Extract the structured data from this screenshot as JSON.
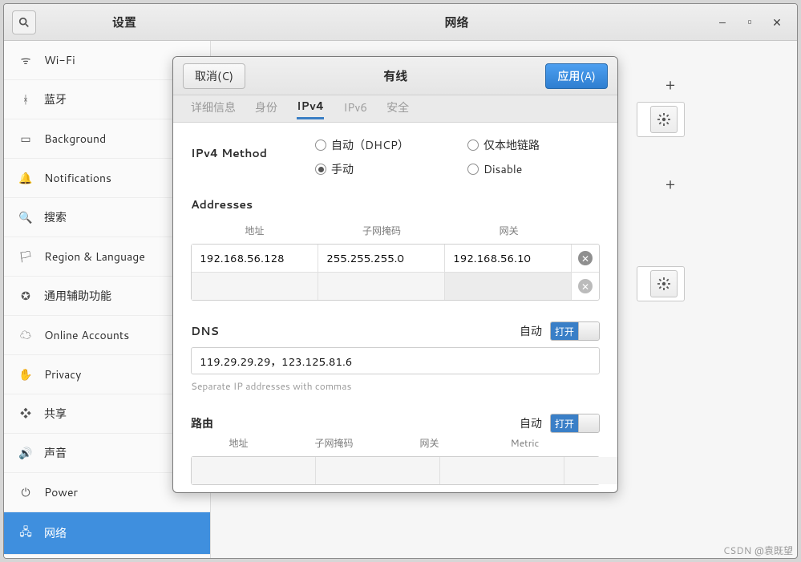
{
  "titlebar": {
    "left_title": "设置",
    "center_title": "网络"
  },
  "sidebar": {
    "items": [
      {
        "icon": "wifi",
        "label": "Wi-Fi"
      },
      {
        "icon": "bluetooth",
        "label": "蓝牙"
      },
      {
        "icon": "background",
        "label": "Background"
      },
      {
        "icon": "bell",
        "label": "Notifications"
      },
      {
        "icon": "search",
        "label": "搜索"
      },
      {
        "icon": "globe",
        "label": "Region & Language"
      },
      {
        "icon": "a11y",
        "label": "通用辅助功能"
      },
      {
        "icon": "cloud",
        "label": "Online Accounts"
      },
      {
        "icon": "privacy",
        "label": "Privacy"
      },
      {
        "icon": "share",
        "label": "共享"
      },
      {
        "icon": "sound",
        "label": "声音"
      },
      {
        "icon": "power",
        "label": "Power"
      },
      {
        "icon": "network",
        "label": "网络"
      }
    ],
    "active_index": 12
  },
  "dialog": {
    "cancel_label": "取消(C)",
    "apply_label": "应用(A)",
    "title": "有线",
    "tabs": [
      "详细信息",
      "身份",
      "IPv4",
      "IPv6",
      "安全"
    ],
    "active_tab": 2,
    "ipv4": {
      "method_label": "IPv4 Method",
      "methods": {
        "auto": "自动（DHCP）",
        "linklocal": "仅本地链路",
        "manual": "手动",
        "disable": "Disable"
      },
      "selected_method": "manual",
      "addresses_label": "Addresses",
      "addr_headers": {
        "address": "地址",
        "netmask": "子网掩码",
        "gateway": "网关"
      },
      "addresses": [
        {
          "address": "192.168.56.128",
          "netmask": "255.255.255.0",
          "gateway": "192.168.56.10"
        },
        {
          "address": "",
          "netmask": "",
          "gateway": ""
        }
      ],
      "dns_label": "DNS",
      "auto_label": "自动",
      "switch_on_label": "打开",
      "dns_value": "119.29.29.29，123.125.81.6",
      "dns_hint": "Separate IP addresses with commas",
      "routes_label": "路由",
      "route_headers": {
        "address": "地址",
        "netmask": "子网掩码",
        "gateway": "网关",
        "metric": "Metric"
      },
      "routes": [
        {
          "address": "",
          "netmask": "",
          "gateway": "",
          "metric": ""
        }
      ]
    }
  },
  "watermark": "CSDN @袁既望"
}
